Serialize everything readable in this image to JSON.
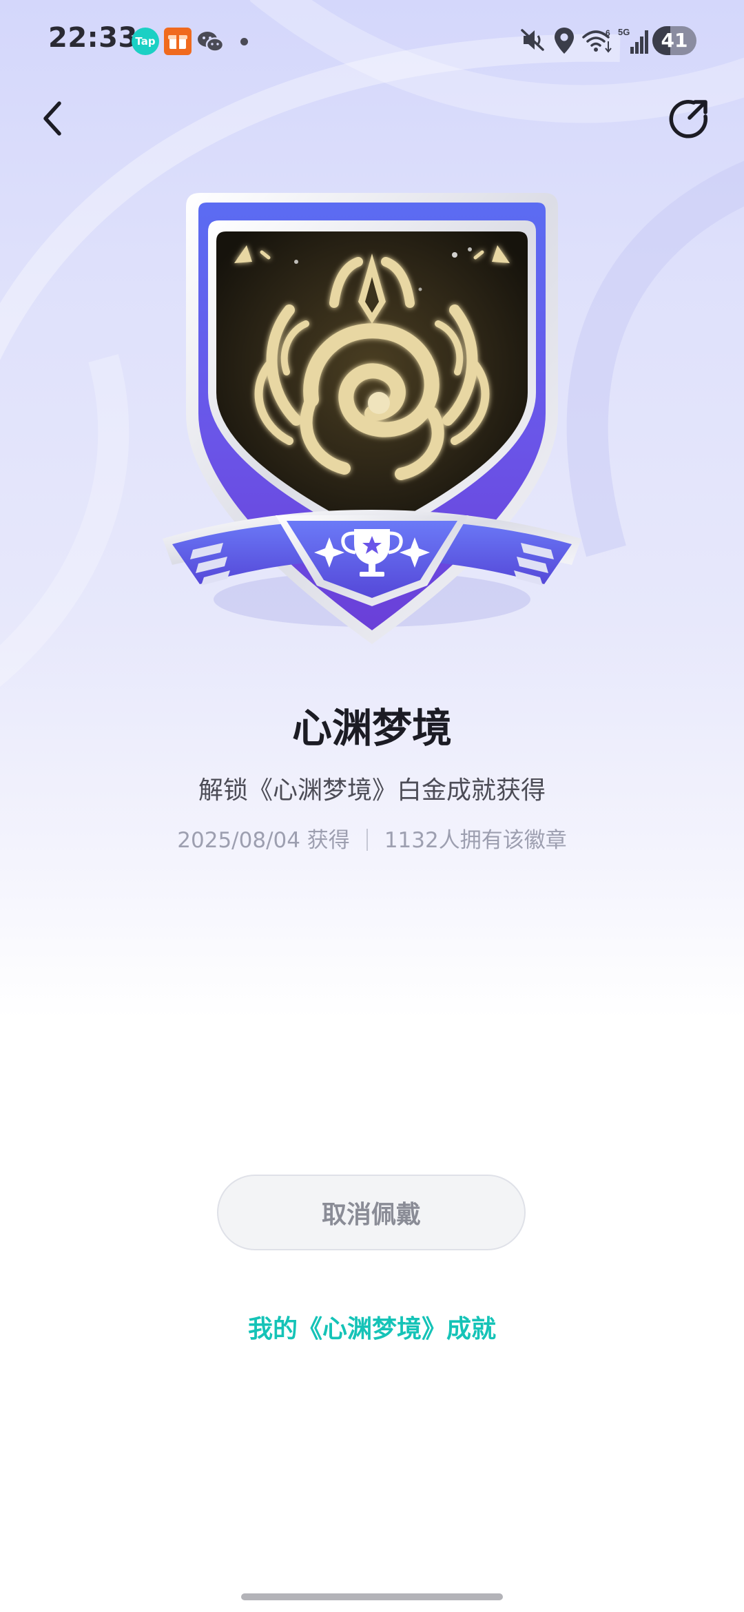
{
  "status_bar": {
    "time": "22:33",
    "tap_app_label": "Tap",
    "battery_level": "41",
    "network": "5G",
    "icons": [
      "tap-app-icon",
      "gift-app-icon",
      "wechat-icon",
      "notification-dot",
      "mute-icon",
      "location-icon",
      "wifi-icon",
      "signal-icon",
      "battery-icon"
    ]
  },
  "nav": {
    "back_icon": "chevron-left-icon",
    "share_icon": "share-icon"
  },
  "badge": {
    "name": "心渊梦境",
    "description": "解锁《心渊梦境》白金成就获得",
    "obtained_date": "2025/08/04 获得",
    "owners": "1132人拥有该徽章"
  },
  "actions": {
    "cancel_wear_label": "取消佩戴",
    "my_achievements_label": "我的《心渊梦境》成就"
  },
  "colors": {
    "shield_blue": "#5a66ee",
    "shield_purple": "#6b4ee0",
    "link_teal": "#15c3b7",
    "emblem_gold": "#e8d7a3"
  }
}
